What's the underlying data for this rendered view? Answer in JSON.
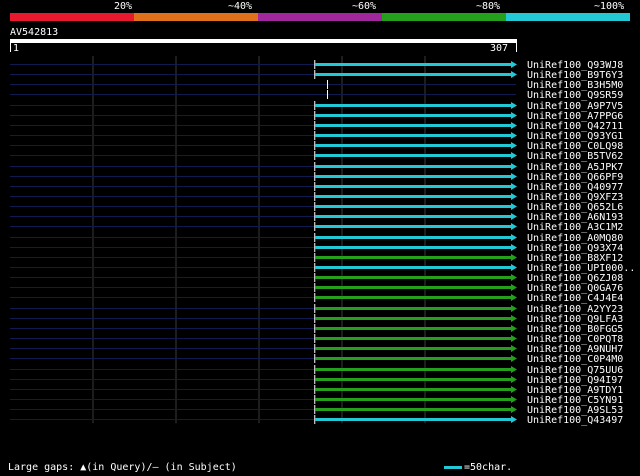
{
  "identity_scale": {
    "labels": [
      "20%",
      "~40%",
      "~60%",
      "~80%",
      "~100%"
    ],
    "colors": [
      "#e8182e",
      "#e0701a",
      "#a0289c",
      "#24a01c",
      "#22c8d6"
    ]
  },
  "query": {
    "name": "AV542813",
    "start": "1",
    "end": "307"
  },
  "hits": [
    {
      "label": "UniRef100_Q93WJ8",
      "identity_color": "#22c8d6",
      "start": 185,
      "end": 307,
      "stub": false
    },
    {
      "label": "UniRef100_B9T6Y3",
      "identity_color": "#22c8d6",
      "start": 185,
      "end": 307,
      "stub": false
    },
    {
      "label": "UniRef100_B3H5M0",
      "identity_color": "#22c8d6",
      "start": 193,
      "end": 193,
      "stub": true
    },
    {
      "label": "UniRef100_Q9SR59",
      "identity_color": "#22c8d6",
      "start": 193,
      "end": 193,
      "stub": true
    },
    {
      "label": "UniRef100_A9P7V5",
      "identity_color": "#22c8d6",
      "start": 185,
      "end": 307,
      "stub": false
    },
    {
      "label": "UniRef100_A7PPG6",
      "identity_color": "#22c8d6",
      "start": 185,
      "end": 307,
      "stub": false
    },
    {
      "label": "UniRef100_Q42711",
      "identity_color": "#22c8d6",
      "start": 185,
      "end": 307,
      "stub": false
    },
    {
      "label": "UniRef100_Q93YG1",
      "identity_color": "#22c8d6",
      "start": 185,
      "end": 307,
      "stub": false
    },
    {
      "label": "UniRef100_C0LQ98",
      "identity_color": "#22c8d6",
      "start": 185,
      "end": 307,
      "stub": false
    },
    {
      "label": "UniRef100_B5TV62",
      "identity_color": "#22c8d6",
      "start": 185,
      "end": 307,
      "stub": false
    },
    {
      "label": "UniRef100_A5JPK7",
      "identity_color": "#22c8d6",
      "start": 185,
      "end": 307,
      "stub": false
    },
    {
      "label": "UniRef100_Q66PF9",
      "identity_color": "#22c8d6",
      "start": 185,
      "end": 307,
      "stub": false
    },
    {
      "label": "UniRef100_Q40977",
      "identity_color": "#22c8d6",
      "start": 185,
      "end": 307,
      "stub": false
    },
    {
      "label": "UniRef100_Q9XFZ3",
      "identity_color": "#22c8d6",
      "start": 185,
      "end": 307,
      "stub": false
    },
    {
      "label": "UniRef100_Q652L6",
      "identity_color": "#22c8d6",
      "start": 185,
      "end": 307,
      "stub": false
    },
    {
      "label": "UniRef100_A6N193",
      "identity_color": "#22c8d6",
      "start": 185,
      "end": 307,
      "stub": false
    },
    {
      "label": "UniRef100_A3C1M2",
      "identity_color": "#22c8d6",
      "start": 185,
      "end": 307,
      "stub": false
    },
    {
      "label": "UniRef100_A0MQ80",
      "identity_color": "#22c8d6",
      "start": 185,
      "end": 307,
      "stub": false
    },
    {
      "label": "UniRef100_Q93X74",
      "identity_color": "#22c8d6",
      "start": 185,
      "end": 307,
      "stub": false
    },
    {
      "label": "UniRef100_B8XF12",
      "identity_color": "#24a01c",
      "start": 185,
      "end": 307,
      "stub": false
    },
    {
      "label": "UniRef100_UPI000..",
      "identity_color": "#22c8d6",
      "start": 185,
      "end": 307,
      "stub": false
    },
    {
      "label": "UniRef100_Q6ZJ08",
      "identity_color": "#24a01c",
      "start": 185,
      "end": 307,
      "stub": false
    },
    {
      "label": "UniRef100_Q0GA76",
      "identity_color": "#24a01c",
      "start": 185,
      "end": 307,
      "stub": false
    },
    {
      "label": "UniRef100_C4J4E4",
      "identity_color": "#24a01c",
      "start": 185,
      "end": 307,
      "stub": false
    },
    {
      "label": "UniRef100_A2YY23",
      "identity_color": "#24a01c",
      "start": 185,
      "end": 307,
      "stub": false
    },
    {
      "label": "UniRef100_Q9LFA3",
      "identity_color": "#24a01c",
      "start": 185,
      "end": 307,
      "stub": false
    },
    {
      "label": "UniRef100_B0FGG5",
      "identity_color": "#24a01c",
      "start": 185,
      "end": 307,
      "stub": false
    },
    {
      "label": "UniRef100_C0PQT8",
      "identity_color": "#24a01c",
      "start": 185,
      "end": 307,
      "stub": false
    },
    {
      "label": "UniRef100_A9NUH7",
      "identity_color": "#24a01c",
      "start": 185,
      "end": 307,
      "stub": false
    },
    {
      "label": "UniRef100_C0P4M0",
      "identity_color": "#24a01c",
      "start": 185,
      "end": 307,
      "stub": false
    },
    {
      "label": "UniRef100_Q75UU6",
      "identity_color": "#24a01c",
      "start": 185,
      "end": 307,
      "stub": false
    },
    {
      "label": "UniRef100_Q94I97",
      "identity_color": "#24a01c",
      "start": 185,
      "end": 307,
      "stub": false
    },
    {
      "label": "UniRef100_A9TDY1",
      "identity_color": "#24a01c",
      "start": 185,
      "end": 307,
      "stub": false
    },
    {
      "label": "UniRef100_C5YN91",
      "identity_color": "#24a01c",
      "start": 185,
      "end": 307,
      "stub": false
    },
    {
      "label": "UniRef100_A9SL53",
      "identity_color": "#24a01c",
      "start": 185,
      "end": 307,
      "stub": false
    },
    {
      "label": "UniRef100_Q43497",
      "identity_color": "#22c8d6",
      "start": 185,
      "end": 307,
      "stub": false
    }
  ],
  "footer": {
    "gaps_text": "Large gaps: ▲(in Query)/— (in Subject)",
    "legend_text": "=50char."
  },
  "colors": {
    "background": "#000000",
    "query_line": "#101a50",
    "gridline": "#3a3a3a"
  }
}
